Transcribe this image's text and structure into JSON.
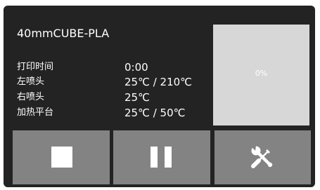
{
  "job": {
    "name": "40mmCUBE-PLA"
  },
  "stats": [
    {
      "label": "打印时间",
      "value": "0:00"
    },
    {
      "label": "左喷头",
      "value": "25℃ / 210℃"
    },
    {
      "label": "右喷头",
      "value": "25℃"
    },
    {
      "label": "加热平台",
      "value": "25℃ / 50℃"
    }
  ],
  "progress": {
    "text": "0%",
    "value": 0
  },
  "controls": {
    "stop_icon": "stop-icon",
    "pause_icon": "pause-icon",
    "tools_icon": "tools-icon"
  },
  "colors": {
    "screen_background": "#232323",
    "button_background": "#838383",
    "preview_background": "#d7d7d7",
    "text": "#ffffff"
  }
}
